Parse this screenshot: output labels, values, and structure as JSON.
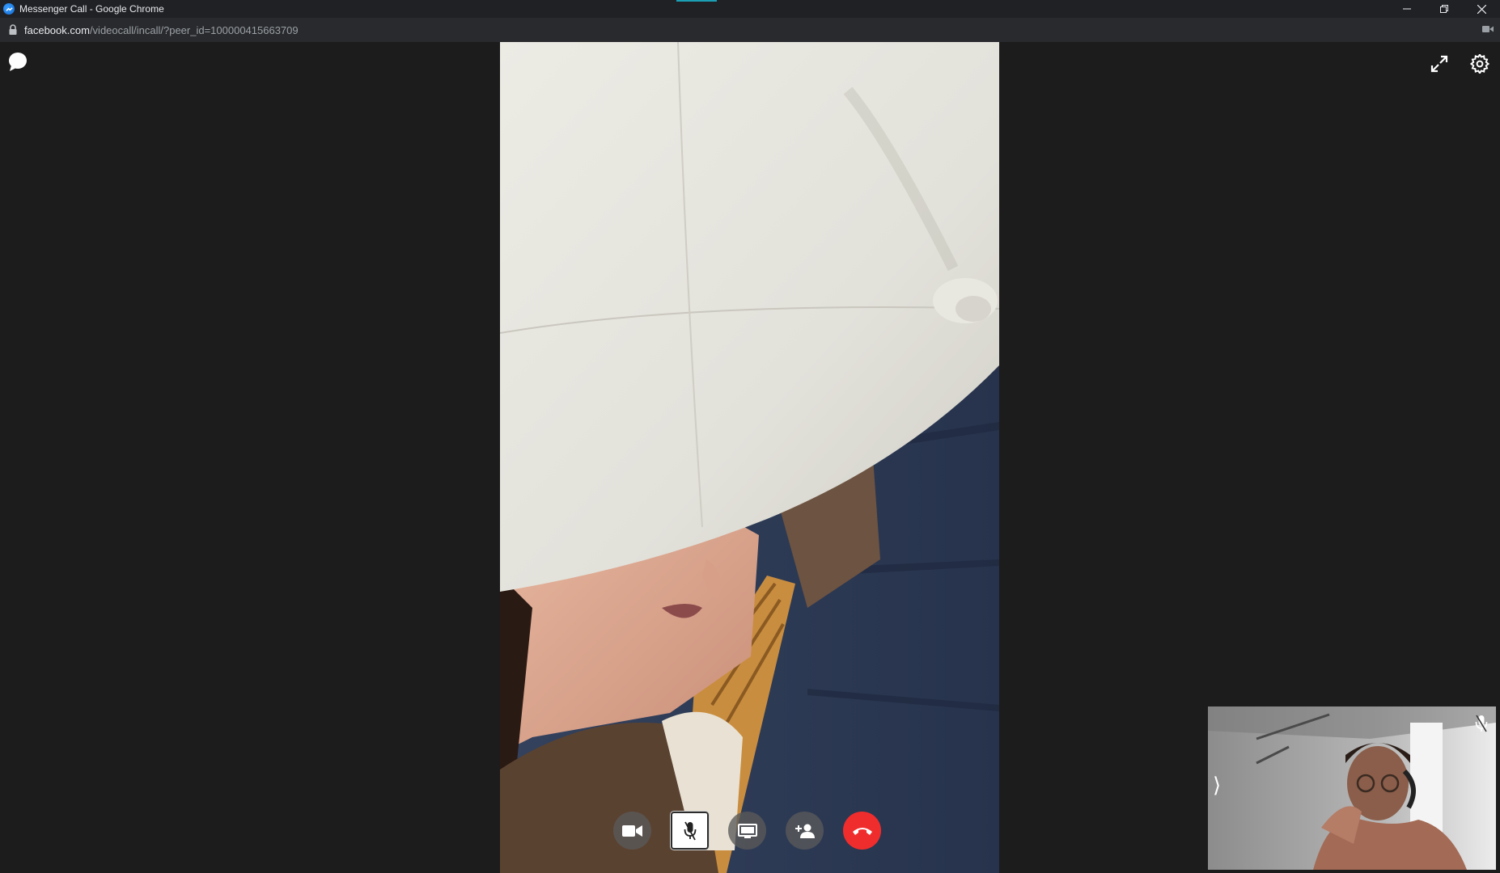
{
  "window": {
    "title": "Messenger Call - Google Chrome",
    "controls": [
      "minimize",
      "restore",
      "close"
    ]
  },
  "address": {
    "host": "facebook.com",
    "path": "/videocall/incall/?peer_id=100000415663709"
  },
  "icons": {
    "chat": "chat-bubble-icon",
    "expand": "expand-icon",
    "settings": "gear-icon",
    "camera_indicator": "camera-indicator-icon"
  },
  "call_controls": [
    {
      "name": "video-toggle-button",
      "icon": "video-camera-icon"
    },
    {
      "name": "mute-button",
      "icon": "microphone-muted-icon",
      "state": "active"
    },
    {
      "name": "share-screen-button",
      "icon": "screen-icon"
    },
    {
      "name": "add-person-button",
      "icon": "add-person-icon"
    },
    {
      "name": "end-call-button",
      "icon": "hang-up-icon",
      "color": "#f02d2d"
    }
  ],
  "self_view": {
    "muted_icon": "microphone-muted-icon",
    "toggle_glyph": "⟩"
  },
  "colors": {
    "background": "#1c1c1c",
    "end_call": "#f02d2d",
    "chrome_bar": "#202124"
  }
}
